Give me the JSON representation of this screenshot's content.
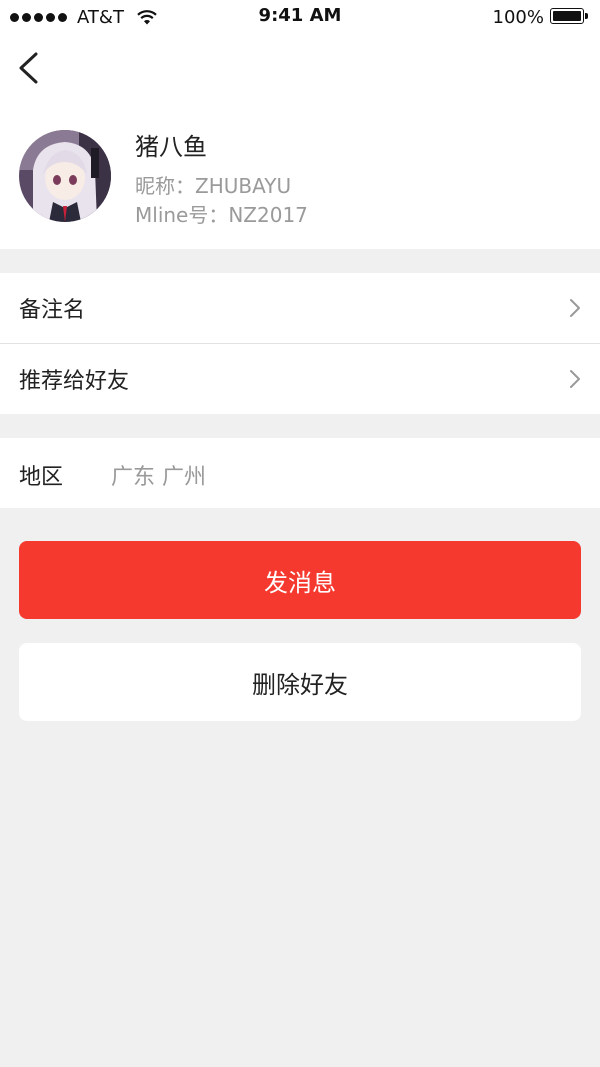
{
  "status_bar": {
    "carrier": "AT&T",
    "time": "9:41 AM",
    "battery": "100%",
    "signal_icon": "signal-dots-icon",
    "wifi_icon": "wifi-icon",
    "battery_icon": "battery-icon"
  },
  "header": {
    "back_icon": "back-arrow-icon"
  },
  "profile": {
    "name": "猪八鱼",
    "nickname": "昵称：ZHUBAYU",
    "mline_id": "Mline号：NZ2017"
  },
  "menu": {
    "items": [
      {
        "label": "备注名",
        "icon": "chevron-right-icon"
      },
      {
        "label": "推荐给好友",
        "icon": "chevron-right-icon"
      }
    ]
  },
  "region": {
    "label": "地区",
    "value": "广东 广州"
  },
  "actions": {
    "send_message": "发消息",
    "delete_friend": "删除好友"
  },
  "colors": {
    "accent": "#f5392f",
    "background": "#f0f0f0",
    "muted_text": "#9a9a9a"
  }
}
